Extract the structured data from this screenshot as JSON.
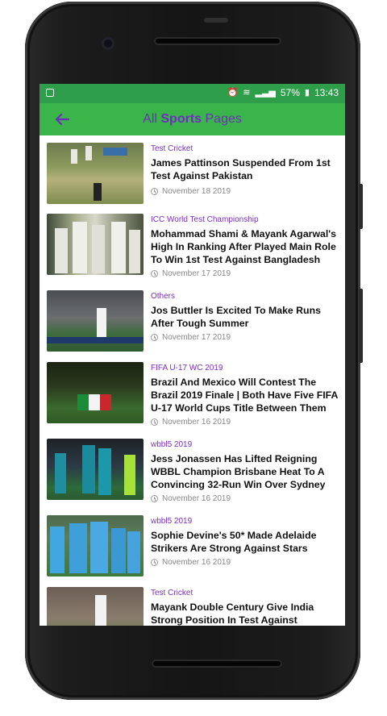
{
  "status": {
    "battery": "57%",
    "time": "13:43"
  },
  "appbar": {
    "title_pre": "All ",
    "title_bold": "Sports",
    "title_post": " Pages"
  },
  "articles": [
    {
      "category": "Test Cricket",
      "headline": "James Pattinson Suspended From 1st Test Against Pakistan",
      "date": "November 18 2019"
    },
    {
      "category": "ICC World Test Championship",
      "headline": "Mohammad Shami & Mayank Agarwal's High In Ranking After Played Main Role To Win 1st Test Against Bangladesh",
      "date": "November 17 2019"
    },
    {
      "category": "Others",
      "headline": "Jos Buttler Is Excited To Make Runs After Tough Summer",
      "date": "November 17 2019"
    },
    {
      "category": "FIFA U-17 WC 2019",
      "headline": "Brazil And Mexico Will Contest The Brazil 2019 Finale | Both Have Five FIFA U-17 World Cups Title Between Them",
      "date": "November 16 2019"
    },
    {
      "category": "wbbl5 2019",
      "headline": "Jess Jonassen Has Lifted Reigning WBBL Champion Brisbane Heat To A Convincing 32-Run Win Over Sydney",
      "date": "November 16 2019"
    },
    {
      "category": "wbbl5 2019",
      "headline": "Sophie Devine's 50* Made Adelaide Strikers Are Strong Against Stars",
      "date": "November 16 2019"
    },
    {
      "category": "Test Cricket",
      "headline": "Mayank Double Century Give India Strong Position In Test Against",
      "date": ""
    }
  ],
  "colors": {
    "status_bar": "#2e9e4a",
    "app_bar": "#3ab54a",
    "accent": "#6f2dbd"
  }
}
